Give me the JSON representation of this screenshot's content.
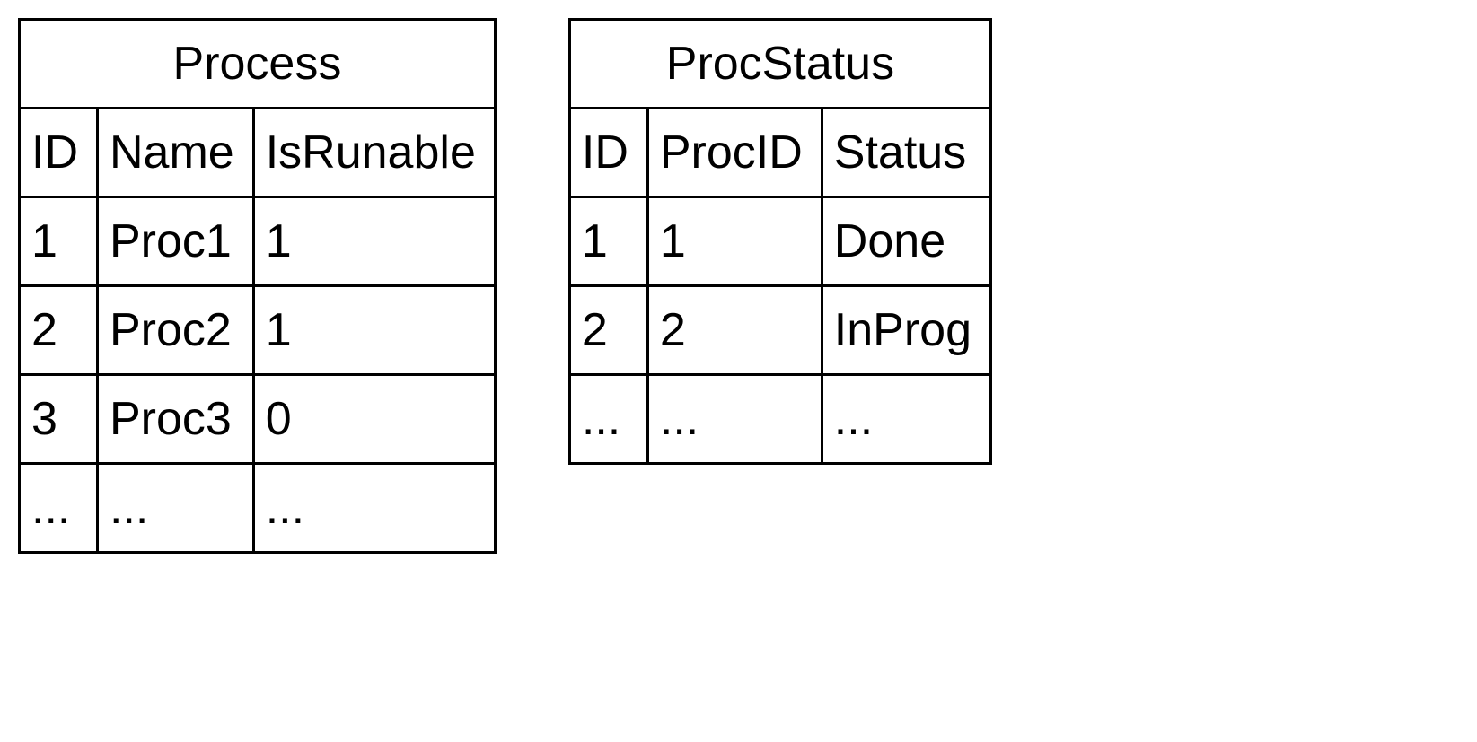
{
  "tables": [
    {
      "title": "Process",
      "columns": [
        "ID",
        "Name",
        "IsRunable"
      ],
      "rows": [
        [
          "1",
          "Proc1",
          "1"
        ],
        [
          "2",
          "Proc2",
          "1"
        ],
        [
          "3",
          "Proc3",
          "0"
        ],
        [
          "...",
          "...",
          "..."
        ]
      ]
    },
    {
      "title": "ProcStatus",
      "columns": [
        "ID",
        "ProcID",
        "Status"
      ],
      "rows": [
        [
          "1",
          "1",
          "Done"
        ],
        [
          "2",
          "2",
          "InProg"
        ],
        [
          "...",
          "...",
          "..."
        ]
      ]
    }
  ]
}
